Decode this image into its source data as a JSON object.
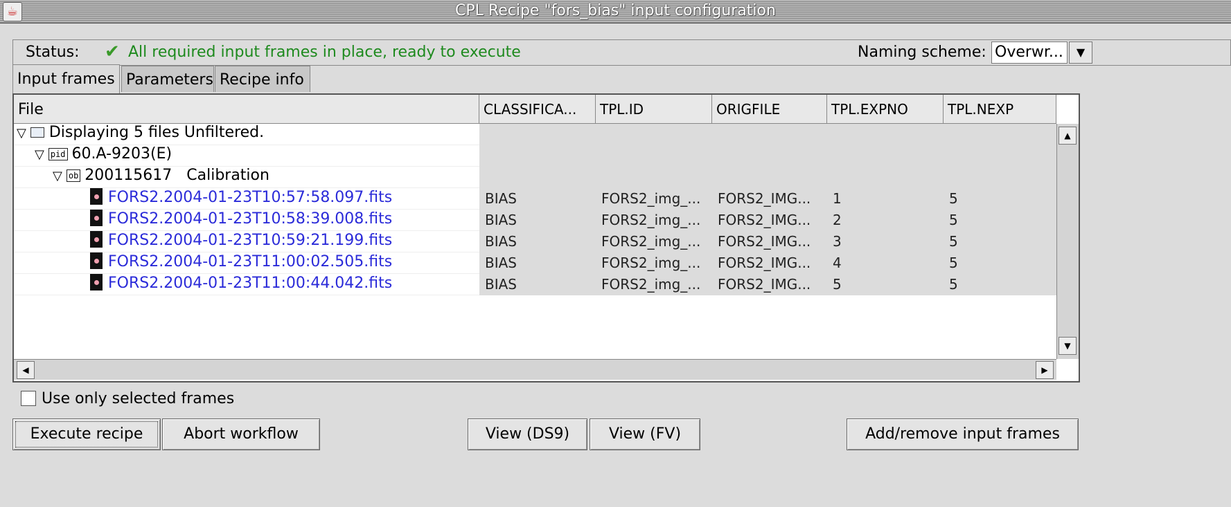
{
  "window": {
    "title": "CPL Recipe \"fors_bias\" input configuration",
    "icon": "java-icon"
  },
  "status": {
    "label": "Status:",
    "check_icon": "checkmark-icon",
    "text": "All required input frames in place, ready to execute",
    "color": "#1e8a1e"
  },
  "naming": {
    "label": "Naming scheme:",
    "value": "Overwr..."
  },
  "tabs": [
    {
      "label": "Input frames",
      "active": true
    },
    {
      "label": "Parameters",
      "active": false
    },
    {
      "label": "Recipe info",
      "active": false
    }
  ],
  "table": {
    "columns": [
      "File",
      "CLASSIFICA...",
      "TPL.ID",
      "ORIGFILE",
      "TPL.EXPNO",
      "TPL.NEXP"
    ],
    "tree": {
      "root": "Displaying 5 files Unfiltered.",
      "pid_tag": "pid",
      "pid": "60.A-9203(E)",
      "ob_tag": "ob",
      "ob": "200115617   Calibration"
    },
    "rows": [
      {
        "file": "FORS2.2004-01-23T10:57:58.097.fits",
        "class": "BIAS",
        "tplid": "FORS2_img_...",
        "origfile": "FORS2_IMG...",
        "expno": "1",
        "nexp": "5"
      },
      {
        "file": "FORS2.2004-01-23T10:58:39.008.fits",
        "class": "BIAS",
        "tplid": "FORS2_img_...",
        "origfile": "FORS2_IMG...",
        "expno": "2",
        "nexp": "5"
      },
      {
        "file": "FORS2.2004-01-23T10:59:21.199.fits",
        "class": "BIAS",
        "tplid": "FORS2_img_...",
        "origfile": "FORS2_IMG...",
        "expno": "3",
        "nexp": "5"
      },
      {
        "file": "FORS2.2004-01-23T11:00:02.505.fits",
        "class": "BIAS",
        "tplid": "FORS2_img_...",
        "origfile": "FORS2_IMG...",
        "expno": "4",
        "nexp": "5"
      },
      {
        "file": "FORS2.2004-01-23T11:00:44.042.fits",
        "class": "BIAS",
        "tplid": "FORS2_img_...",
        "origfile": "FORS2_IMG...",
        "expno": "5",
        "nexp": "5"
      }
    ]
  },
  "options": {
    "use_selected_label": "Use only selected frames",
    "use_selected_checked": false
  },
  "buttons": {
    "execute": "Execute recipe",
    "abort": "Abort workflow",
    "view_ds9": "View (DS9)",
    "view_fv": "View (FV)",
    "add_remove": "Add/remove input frames"
  }
}
